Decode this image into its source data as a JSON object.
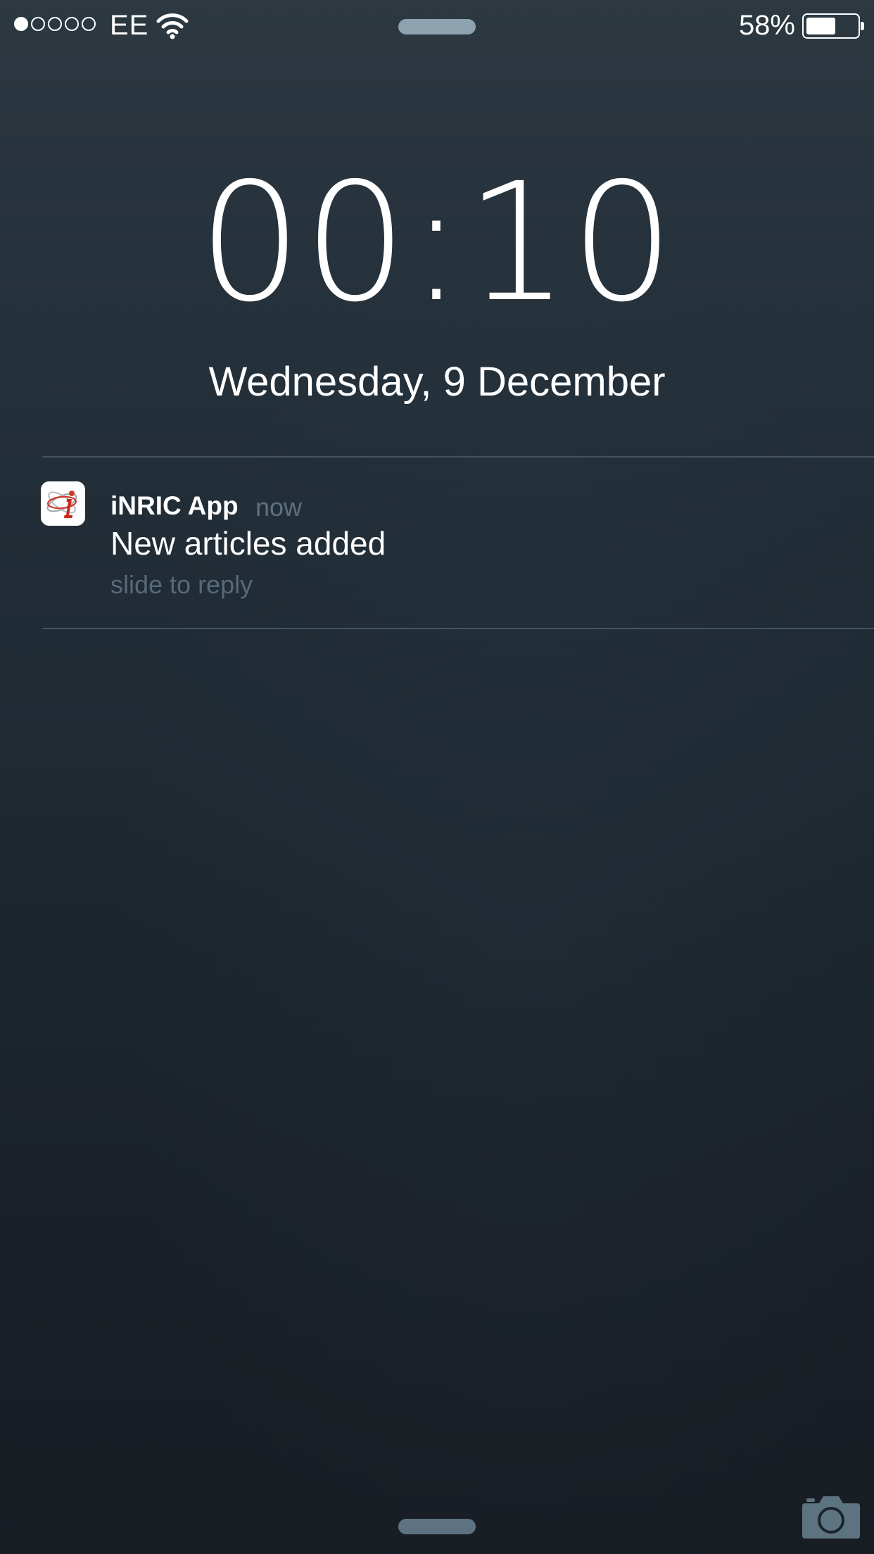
{
  "status_bar": {
    "signal_strength": "1 of 5",
    "carrier": "EE",
    "wifi_icon": "wifi-icon",
    "battery_percent_label": "58%",
    "battery_level": 0.58
  },
  "lock_screen": {
    "time": "00:10",
    "date": "Wednesday, 9 December"
  },
  "notification": {
    "app_icon": "inric-app-icon",
    "app_name": "iNRIC App",
    "time_ago": "now",
    "message": "New articles added",
    "action_hint": "slide to reply"
  },
  "camera_shortcut": {
    "icon": "camera-icon"
  },
  "colors": {
    "background_top": "#2d3841",
    "background_bottom": "#171d23",
    "secondary_text": "#5d7180",
    "grabber": "#8ea2b0",
    "camera": "#5e7382"
  }
}
